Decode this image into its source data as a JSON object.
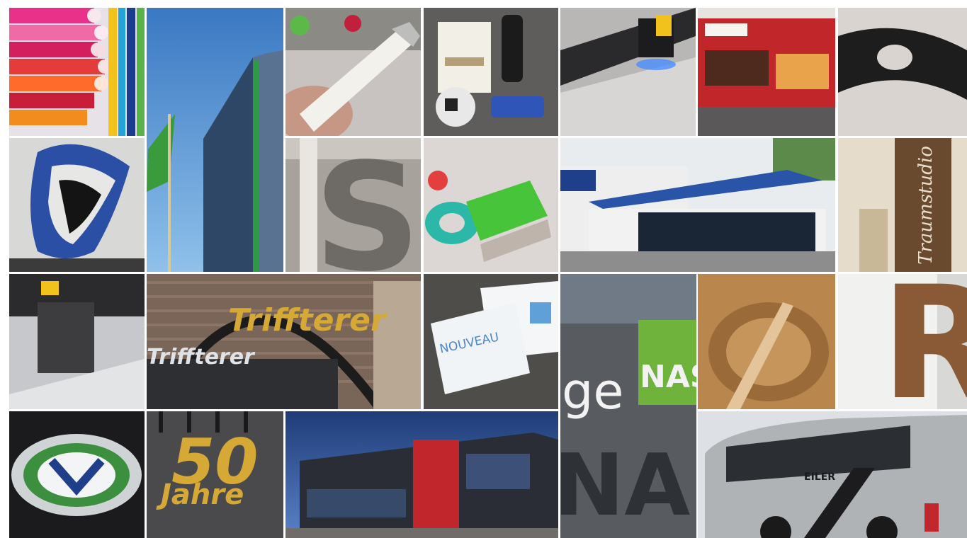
{
  "collage": {
    "sign_triffterer_top": "Triffterer",
    "sign_triffterer_front": "Triffterer",
    "card_nouveau": "NOUVEAU",
    "sign_ge": "ge",
    "sign_nasc_green": "NASC",
    "sign_nasc_big": "NASC",
    "embroidery_50": "50",
    "embroidery_jahre": "Jahre",
    "bus_brand": "EILER",
    "letter_s": "S",
    "letter_r": "R",
    "script_sign": "Traumstudio"
  },
  "colors": {
    "sky_blue": "#3f7fc4",
    "gold": "#d6a936",
    "nasc_green": "#6fb23c",
    "bus_red": "#c1272d",
    "building_red": "#c0262b"
  }
}
